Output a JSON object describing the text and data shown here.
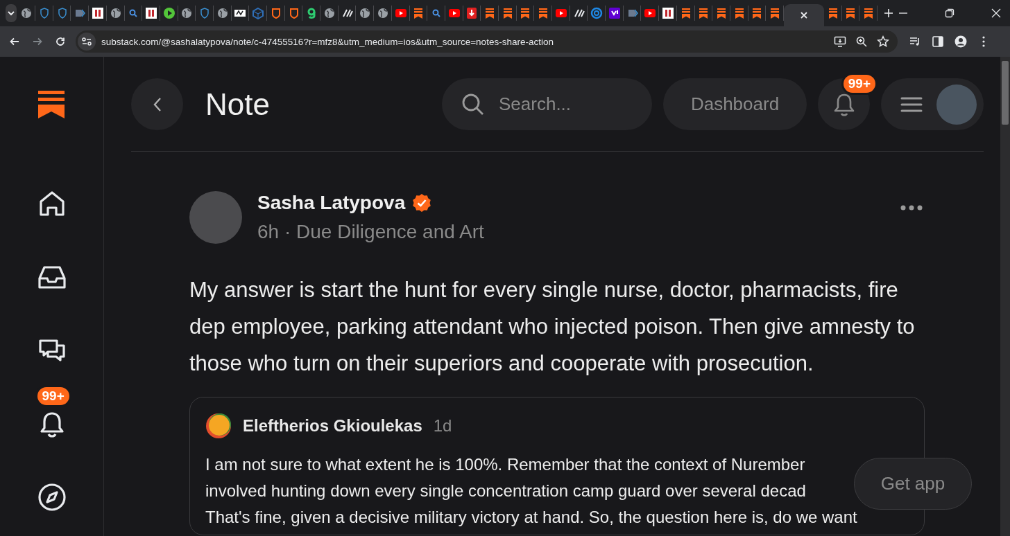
{
  "browser": {
    "tabs": [
      {
        "kind": "globe",
        "selected": false
      },
      {
        "kind": "shield",
        "selected": false
      },
      {
        "kind": "shield",
        "selected": false
      },
      {
        "kind": "tag",
        "selected": false
      },
      {
        "kind": "redbox",
        "selected": false
      },
      {
        "kind": "globe",
        "selected": false
      },
      {
        "kind": "search",
        "selected": false
      },
      {
        "kind": "redbox",
        "selected": false
      },
      {
        "kind": "play",
        "selected": false
      },
      {
        "kind": "globe",
        "selected": false
      },
      {
        "kind": "shield",
        "selected": false
      },
      {
        "kind": "globe",
        "selected": false
      },
      {
        "kind": "whitebox",
        "selected": false
      },
      {
        "kind": "cube",
        "selected": false
      },
      {
        "kind": "orangeshield",
        "selected": false
      },
      {
        "kind": "orangeshield",
        "selected": false
      },
      {
        "kind": "greenhook",
        "selected": false
      },
      {
        "kind": "globe",
        "selected": false
      },
      {
        "kind": "slash",
        "selected": false
      },
      {
        "kind": "globe",
        "selected": false
      },
      {
        "kind": "globe",
        "selected": false
      },
      {
        "kind": "youtube",
        "selected": false
      },
      {
        "kind": "substack",
        "selected": false
      },
      {
        "kind": "search",
        "selected": false
      },
      {
        "kind": "youtube",
        "selected": false
      },
      {
        "kind": "pin",
        "selected": false
      },
      {
        "kind": "substack",
        "selected": false
      },
      {
        "kind": "substack",
        "selected": false
      },
      {
        "kind": "substack",
        "selected": false
      },
      {
        "kind": "substack",
        "selected": false
      },
      {
        "kind": "youtube",
        "selected": false
      },
      {
        "kind": "slash",
        "selected": false
      },
      {
        "kind": "ring",
        "selected": false
      },
      {
        "kind": "purplebox",
        "selected": false
      },
      {
        "kind": "tag",
        "selected": false
      },
      {
        "kind": "youtube",
        "selected": false
      },
      {
        "kind": "redbox",
        "selected": false
      },
      {
        "kind": "substack",
        "selected": false
      },
      {
        "kind": "substack",
        "selected": false
      },
      {
        "kind": "substack",
        "selected": false
      },
      {
        "kind": "substack",
        "selected": false
      },
      {
        "kind": "substack",
        "selected": false
      },
      {
        "kind": "substack",
        "selected": false
      },
      {
        "selected": true
      },
      {
        "kind": "substack",
        "selected": false
      },
      {
        "kind": "substack",
        "selected": false
      },
      {
        "kind": "substack",
        "selected": false
      }
    ],
    "address": "substack.com/@sashalatypova/note/c-47455516?r=mfz8&utm_medium=ios&utm_source=notes-share-action"
  },
  "sidebar": {
    "items": [
      {
        "kind": "home"
      },
      {
        "kind": "inbox"
      },
      {
        "kind": "chat"
      },
      {
        "kind": "bell",
        "badge": "99+"
      },
      {
        "kind": "explore"
      }
    ]
  },
  "header": {
    "title": "Note",
    "search": {
      "placeholder": "Search..."
    },
    "dashboard": "Dashboard",
    "notifications_badge": "99+"
  },
  "note": {
    "author": "Sasha Latypova",
    "verified": true,
    "meta": "6h · Due Diligence and Art",
    "body": "My answer is start the hunt for every single nurse, doctor, pharmacists, fire dep employee, parking attendant who injected poison. Then give amnesty to those who turn on their superiors and cooperate with prosecution.",
    "quote": {
      "author": "Eleftherios Gkioulekas",
      "time": "1d",
      "lines": [
        "I am not sure to what extent he is 100%. Remember that the context of Nurember",
        "involved hunting down every single concentration camp guard over several decad",
        "That's fine, given a decisive military victory at hand. So, the question here is, do we want"
      ]
    }
  },
  "get_app": "Get app"
}
